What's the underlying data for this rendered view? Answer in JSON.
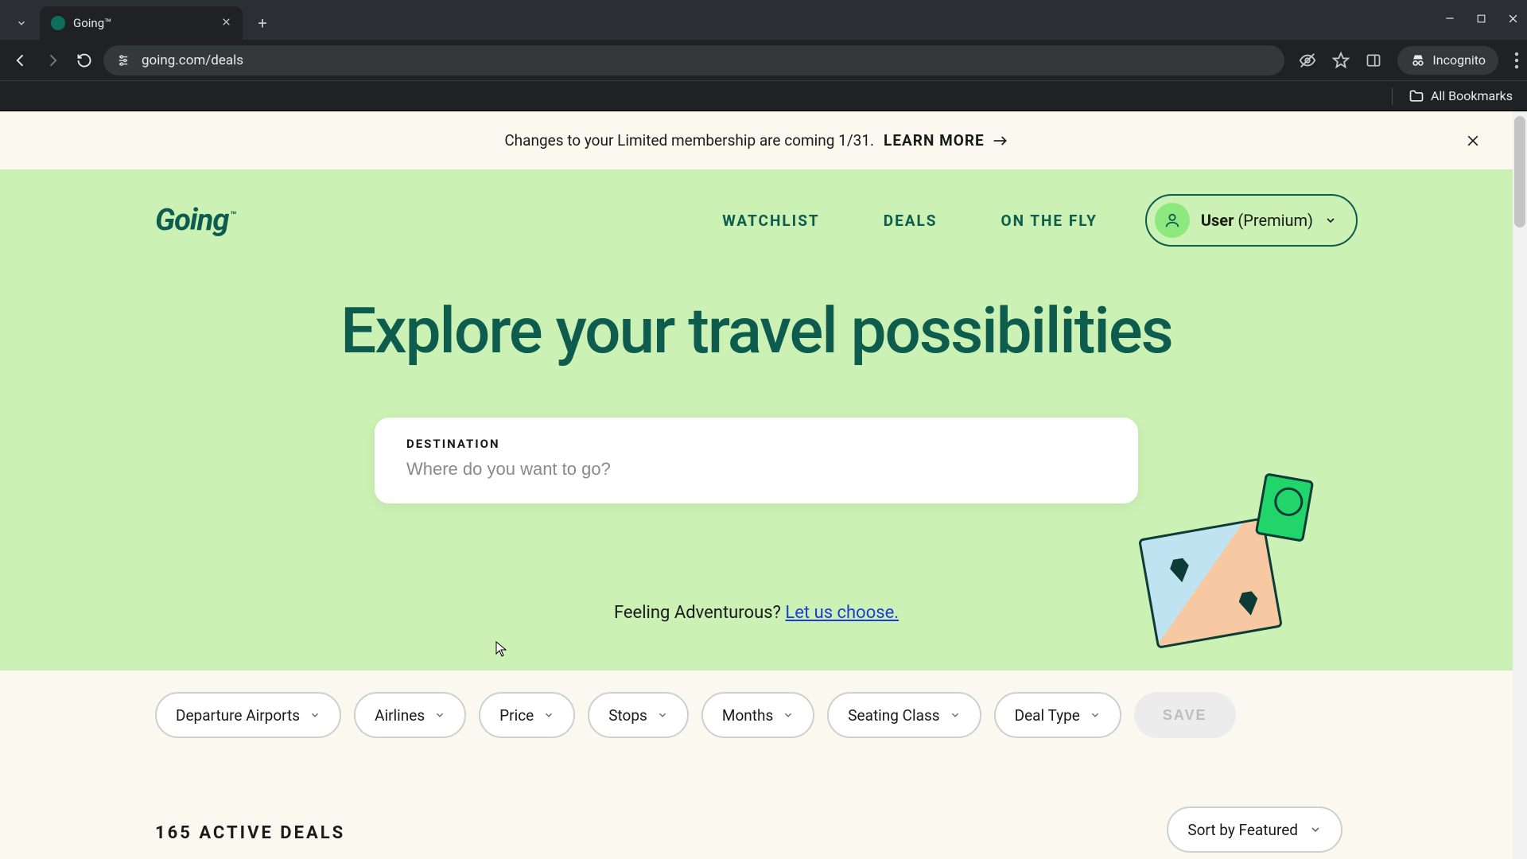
{
  "browser": {
    "tab_title": "Going™",
    "url": "going.com/deals",
    "incognito_label": "Incognito",
    "bookmarks_label": "All Bookmarks"
  },
  "banner": {
    "text": "Changes to your Limited membership are coming 1/31.",
    "cta": "LEARN MORE"
  },
  "nav": {
    "links": [
      "WATCHLIST",
      "DEALS",
      "ON THE FLY"
    ],
    "logo": "Going",
    "tm": "™"
  },
  "user": {
    "name": "User",
    "plan": "(Premium)"
  },
  "hero": {
    "title": "Explore your travel possibilities",
    "search_label": "DESTINATION",
    "search_placeholder": "Where do you want to go?",
    "adventurous_text": "Feeling Adventurous? ",
    "adventurous_link": "Let us choose."
  },
  "filters": {
    "items": [
      "Departure Airports",
      "Airlines",
      "Price",
      "Stops",
      "Months",
      "Seating Class",
      "Deal Type"
    ],
    "save": "SAVE"
  },
  "deals": {
    "count_label": "165 ACTIVE DEALS",
    "sort_label": "Sort by Featured"
  }
}
